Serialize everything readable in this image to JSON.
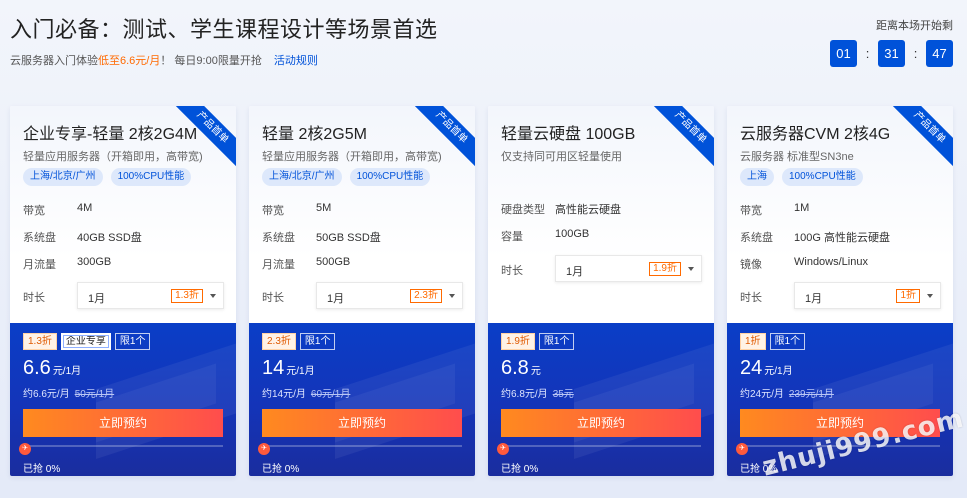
{
  "header": {
    "title": "入门必备：测试、学生课程设计等场景首选",
    "subtitle_prefix": "云服务器入门体验",
    "subtitle_highlight": "低至6.6元/月",
    "subtitle_suffix": "！ 每日9:00限量开抢",
    "rules_link": "活动规则",
    "countdown_label": "距离本场开始剩",
    "countdown": {
      "hours": "01",
      "minutes": "31",
      "seconds": "47",
      "sep": ":"
    }
  },
  "ribbon_label": "产品首单",
  "duration_label": "时长",
  "sold_label": "已抢 0%",
  "cards": [
    {
      "title": "企业专享-轻量 2核2G4M",
      "desc": "轻量应用服务器（开箱即用，高带宽)",
      "tags": [
        "上海/北京/广州",
        "100%CPU性能"
      ],
      "specs": [
        {
          "label": "带宽",
          "value": "4M"
        },
        {
          "label": "系统盘",
          "value": "40GB SSD盘"
        },
        {
          "label": "月流量",
          "value": "300GB"
        }
      ],
      "duration": {
        "value": "1月",
        "discount": "1.3折"
      },
      "badges": {
        "discount": "1.3折",
        "enterprise": "企业专享",
        "limit": "限1个"
      },
      "price": {
        "num": "6.6",
        "unit": "元/1月"
      },
      "price_sub": {
        "monthly": "约6.6元/月",
        "original": "50元/1月"
      },
      "buy_label": "立即预约",
      "sold_percent": 0
    },
    {
      "title": "轻量 2核2G5M",
      "desc": "轻量应用服务器（开箱即用，高带宽)",
      "tags": [
        "上海/北京/广州",
        "100%CPU性能"
      ],
      "specs": [
        {
          "label": "带宽",
          "value": "5M"
        },
        {
          "label": "系统盘",
          "value": "50GB SSD盘"
        },
        {
          "label": "月流量",
          "value": "500GB"
        }
      ],
      "duration": {
        "value": "1月",
        "discount": "2.3折"
      },
      "badges": {
        "discount": "2.3折",
        "limit": "限1个"
      },
      "price": {
        "num": "14",
        "unit": "元/1月"
      },
      "price_sub": {
        "monthly": "约14元/月",
        "original": "60元/1月"
      },
      "buy_label": "立即预约",
      "sold_percent": 0
    },
    {
      "title": "轻量云硬盘 100GB",
      "desc": "仅支持同可用区轻量使用",
      "tags": [],
      "specs": [
        {
          "label": "硬盘类型",
          "value": "高性能云硬盘"
        },
        {
          "label": "容量",
          "value": "100GB"
        }
      ],
      "duration": {
        "value": "1月",
        "discount": "1.9折"
      },
      "badges": {
        "discount": "1.9折",
        "limit": "限1个"
      },
      "price": {
        "num": "6.8",
        "unit": "元"
      },
      "price_sub": {
        "monthly": "约6.8元/月",
        "original": "35元"
      },
      "buy_label": "立即预约",
      "sold_percent": 0
    },
    {
      "title": "云服务器CVM 2核4G",
      "desc": "云服务器 标准型SN3ne",
      "tags": [
        "上海",
        "100%CPU性能"
      ],
      "specs": [
        {
          "label": "带宽",
          "value": "1M"
        },
        {
          "label": "系统盘",
          "value": "100G 高性能云硬盘"
        },
        {
          "label": "镜像",
          "value": "Windows/Linux"
        }
      ],
      "duration": {
        "value": "1月",
        "discount": "1折"
      },
      "badges": {
        "discount": "1折",
        "limit": "限1个"
      },
      "price": {
        "num": "24",
        "unit": "元/1月"
      },
      "price_sub": {
        "monthly": "约24元/月",
        "original": "239元/1月"
      },
      "buy_label": "立即预约",
      "sold_percent": 0
    }
  ],
  "watermark": "zhuji999.com"
}
